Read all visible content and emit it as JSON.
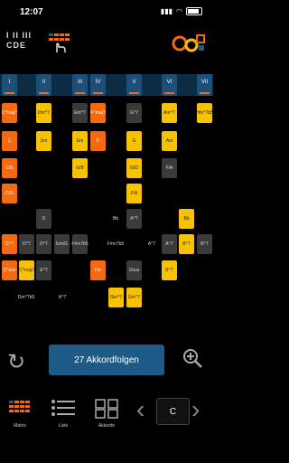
{
  "status": {
    "time": "12:07",
    "signal": "▮▮▮",
    "wifi": "◠"
  },
  "header": {
    "logo_top": "I II III",
    "logo_bottom": "CDE"
  },
  "degrees": [
    "I",
    "II",
    "III",
    "IV",
    "V",
    "VI",
    "VII"
  ],
  "tiles": {
    "c1": [
      "C^maj7",
      "C",
      "C/E",
      "C/G",
      "",
      "",
      "C^7",
      "C^sus",
      "C^maj7"
    ],
    "c2": [
      "Dm^7",
      "Dm",
      "",
      "",
      "D",
      "D^7",
      "D^7",
      "",
      "Dm^7b5"
    ],
    "c3": [
      "Em^7",
      "Em",
      "Em/G",
      "",
      "",
      "E^7",
      "",
      "",
      ""
    ],
    "c4": [
      "F^maj7",
      "F",
      "",
      "",
      "",
      "",
      "F#m7b5",
      "Fm",
      ""
    ],
    "c5": [
      "G^7",
      "G",
      "G/B",
      "G/D",
      "",
      "",
      "",
      "Gsus",
      "Gm^7"
    ],
    "c6": [
      "Am^7",
      "Am",
      "F/A",
      "",
      "",
      "A^7",
      "",
      "",
      ""
    ],
    "c7": [
      "Hm^7b5",
      "",
      "",
      "",
      "Bb",
      "B^7",
      "",
      "",
      ""
    ]
  },
  "main": {
    "count_label": "27 Akkordfolgen"
  },
  "tabs": [
    {
      "label": "Matrix"
    },
    {
      "label": "Liste"
    },
    {
      "label": "Akkorde"
    }
  ],
  "key": {
    "value": "C"
  }
}
